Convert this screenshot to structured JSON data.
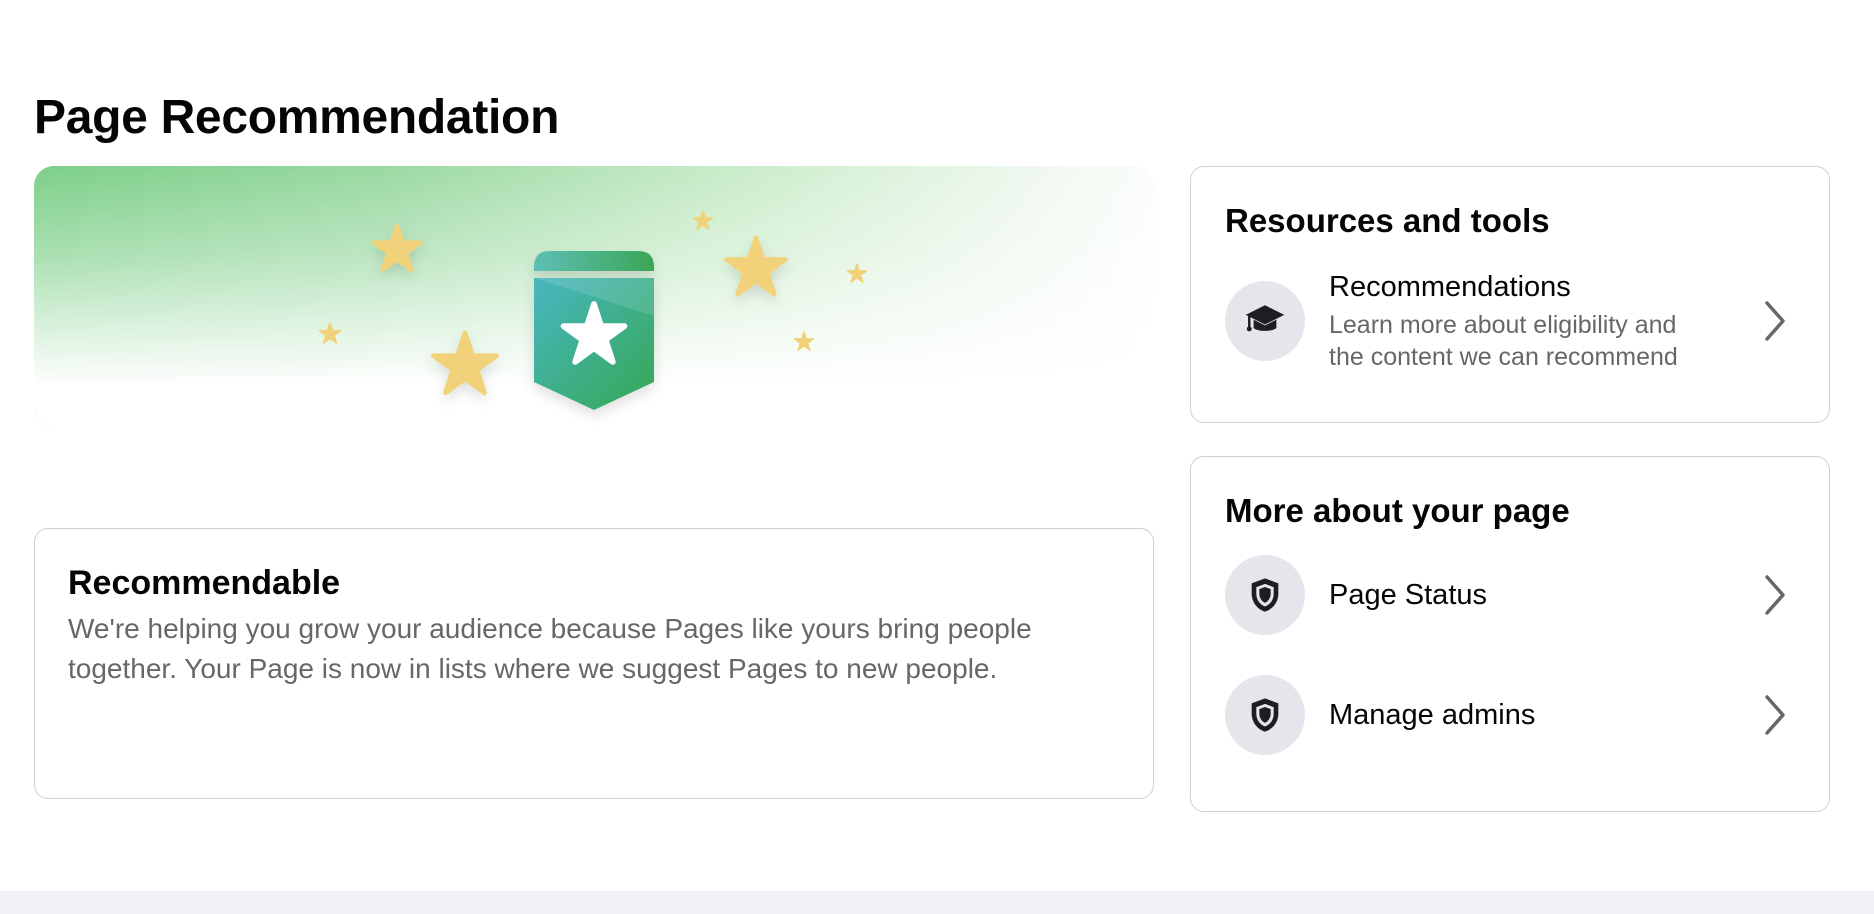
{
  "page": {
    "title": "Page Recommendation"
  },
  "hero": {
    "icon": "recommendation-badge-icon",
    "colors": {
      "banner_green": "#7ccf88",
      "star_yellow": "#f1d27a",
      "badge_teal": "#4fb8b8",
      "badge_green": "#3aa655"
    }
  },
  "recommendable": {
    "title": "Recommendable",
    "description": "We're helping you grow your audience because Pages like yours bring people together. Your Page is now in lists where we suggest Pages to new people."
  },
  "resources": {
    "title": "Resources and tools",
    "items": [
      {
        "icon": "graduation-cap-icon",
        "title": "Recommendations",
        "subtitle_line1": "Learn more about eligibility and",
        "subtitle_line2": "the content we can recommend"
      }
    ]
  },
  "more": {
    "title": "More about your page",
    "items": [
      {
        "icon": "shield-icon",
        "title": "Page Status"
      },
      {
        "icon": "shield-icon",
        "title": "Manage admins"
      }
    ]
  }
}
